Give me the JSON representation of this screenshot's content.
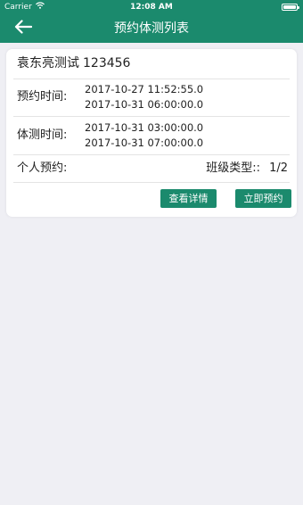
{
  "status_bar": {
    "carrier": "Carrier",
    "time": "12:08 AM"
  },
  "header": {
    "title": "预约体测列表"
  },
  "record": {
    "name": "袁东亮测试",
    "code": "123456",
    "booking_time_label": "预约时间:",
    "booking_start": "2017-10-27 11:52:55.0",
    "booking_end": "2017-10-31 06:00:00.0",
    "test_time_label": "体测时间:",
    "test_start": "2017-10-31 03:00:00.0",
    "test_end": "2017-10-31 07:00:00.0",
    "personal_booking_label": "个人预约:",
    "class_type_label": "班级类型::",
    "class_type_value": "1/2",
    "detail_button": "查看详情",
    "book_button": "立即预约"
  },
  "colors": {
    "brand": "#1b8a6d",
    "background": "#efeff4"
  }
}
